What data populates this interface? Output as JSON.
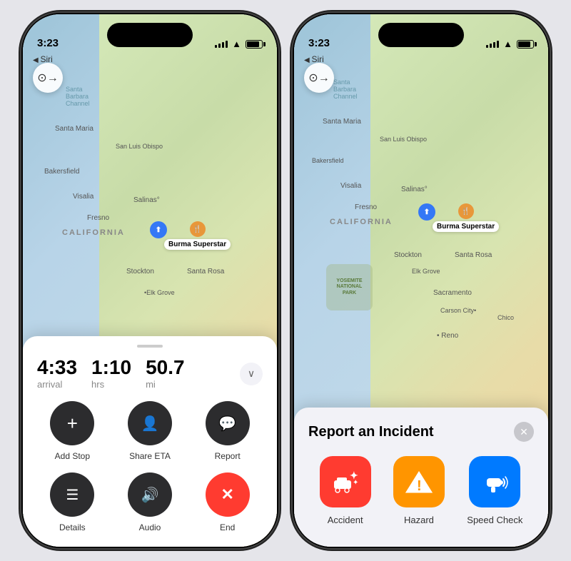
{
  "phones": [
    {
      "id": "left-phone",
      "status_bar": {
        "time": "3:23",
        "time_arrow": "▲",
        "siri_label": "Siri"
      },
      "nav_back_icon": "⊙→",
      "map": {
        "location": "California Coast",
        "pin_label": "Burma Superstar",
        "destination_color": "#e8973a"
      },
      "eta_panel": {
        "arrival_value": "4:33",
        "arrival_label": "arrival",
        "hrs_value": "1:10",
        "hrs_label": "hrs",
        "miles_value": "50.7",
        "miles_label": "mi"
      },
      "actions": [
        {
          "id": "add-stop",
          "icon": "+",
          "label": "Add Stop",
          "style": "dark"
        },
        {
          "id": "share-eta",
          "icon": "👤+",
          "label": "Share ETA",
          "style": "dark"
        },
        {
          "id": "report",
          "icon": "💬",
          "label": "Report",
          "style": "dark"
        },
        {
          "id": "details",
          "icon": "☰",
          "label": "Details",
          "style": "dark"
        },
        {
          "id": "audio",
          "icon": "🔊",
          "label": "Audio",
          "style": "dark"
        },
        {
          "id": "end",
          "icon": "✕",
          "label": "End",
          "style": "red"
        }
      ]
    },
    {
      "id": "right-phone",
      "status_bar": {
        "time": "3:23",
        "siri_label": "Siri"
      },
      "nav_back_icon": "⊙→",
      "map": {
        "location": "California Coast",
        "pin_label": "Burma Superstar"
      },
      "incident_panel": {
        "title": "Report an Incident",
        "close_icon": "✕",
        "options": [
          {
            "id": "accident",
            "label": "Accident",
            "icon": "🚗",
            "style": "red-bg"
          },
          {
            "id": "hazard",
            "label": "Hazard",
            "icon": "⚠",
            "style": "orange-bg"
          },
          {
            "id": "speed-check",
            "label": "Speed Check",
            "icon": "📡",
            "style": "blue-bg"
          }
        ]
      }
    }
  ]
}
